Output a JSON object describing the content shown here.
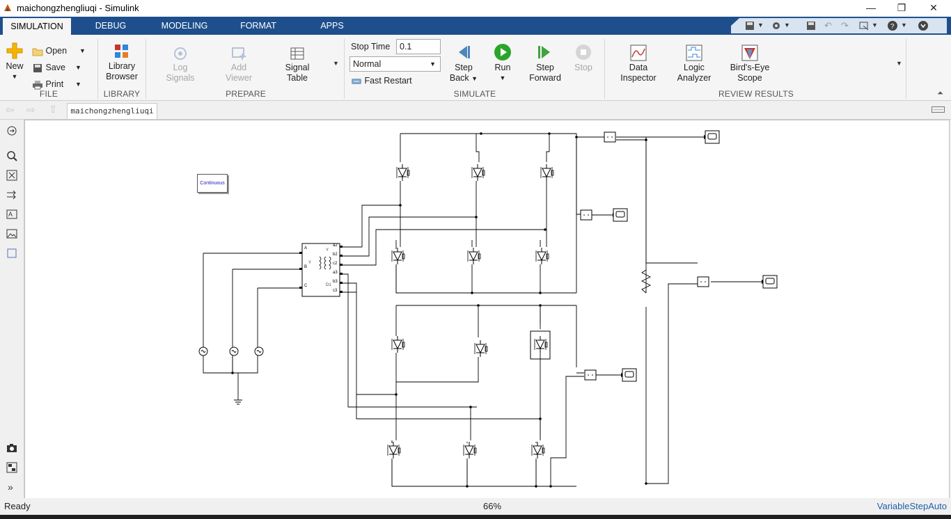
{
  "window": {
    "title": "maichongzhengliuqi - Simulink",
    "min_glyph": "—",
    "max_glyph": "❐",
    "close_glyph": "✕"
  },
  "tabs": [
    {
      "label": "SIMULATION",
      "active": true
    },
    {
      "label": "DEBUG"
    },
    {
      "label": "MODELING"
    },
    {
      "label": "FORMAT"
    },
    {
      "label": "APPS"
    }
  ],
  "ribbon": {
    "file": {
      "label": "FILE",
      "new_label": "New",
      "open_label": "Open",
      "save_label": "Save",
      "print_label": "Print"
    },
    "library": {
      "label": "LIBRARY",
      "browser_label_1": "Library",
      "browser_label_2": "Browser"
    },
    "prepare": {
      "label": "PREPARE",
      "log_signals_1": "Log",
      "log_signals_2": "Signals",
      "add_viewer_1": "Add",
      "add_viewer_2": "Viewer",
      "signal_table_1": "Signal",
      "signal_table_2": "Table"
    },
    "simulate": {
      "label": "SIMULATE",
      "stop_time_label": "Stop Time",
      "stop_time_value": "0.1",
      "mode_value": "Normal",
      "fast_restart_label": "Fast Restart",
      "step_back_1": "Step",
      "step_back_2": "Back",
      "run_label": "Run",
      "step_forward_1": "Step",
      "step_forward_2": "Forward",
      "stop_label": "Stop"
    },
    "review": {
      "label": "REVIEW RESULTS",
      "data_inspector_1": "Data",
      "data_inspector_2": "Inspector",
      "logic_analyzer_1": "Logic",
      "logic_analyzer_2": "Analyzer",
      "birds_eye_1": "Bird's-Eye",
      "birds_eye_2": "Scope"
    }
  },
  "nav": {
    "doc_tab": "maichongzhengliuqi"
  },
  "diagram": {
    "continuous_block": "Continuous",
    "transformer_ports_left": [
      "A",
      "B",
      "C"
    ],
    "transformer_ports_right": [
      "a2",
      "b2",
      "c2",
      "a3",
      "b3",
      "c3"
    ],
    "transformer_label_y1": "Y",
    "transformer_label_y2": "Y",
    "transformer_label_d": "D1"
  },
  "status": {
    "left": "Ready",
    "zoom": "66%",
    "solver": "VariableStepAuto"
  },
  "colors": {
    "tabbar": "#1e4f8c",
    "solver_link": "#1f5fa8",
    "run_green": "#2aa52a"
  }
}
